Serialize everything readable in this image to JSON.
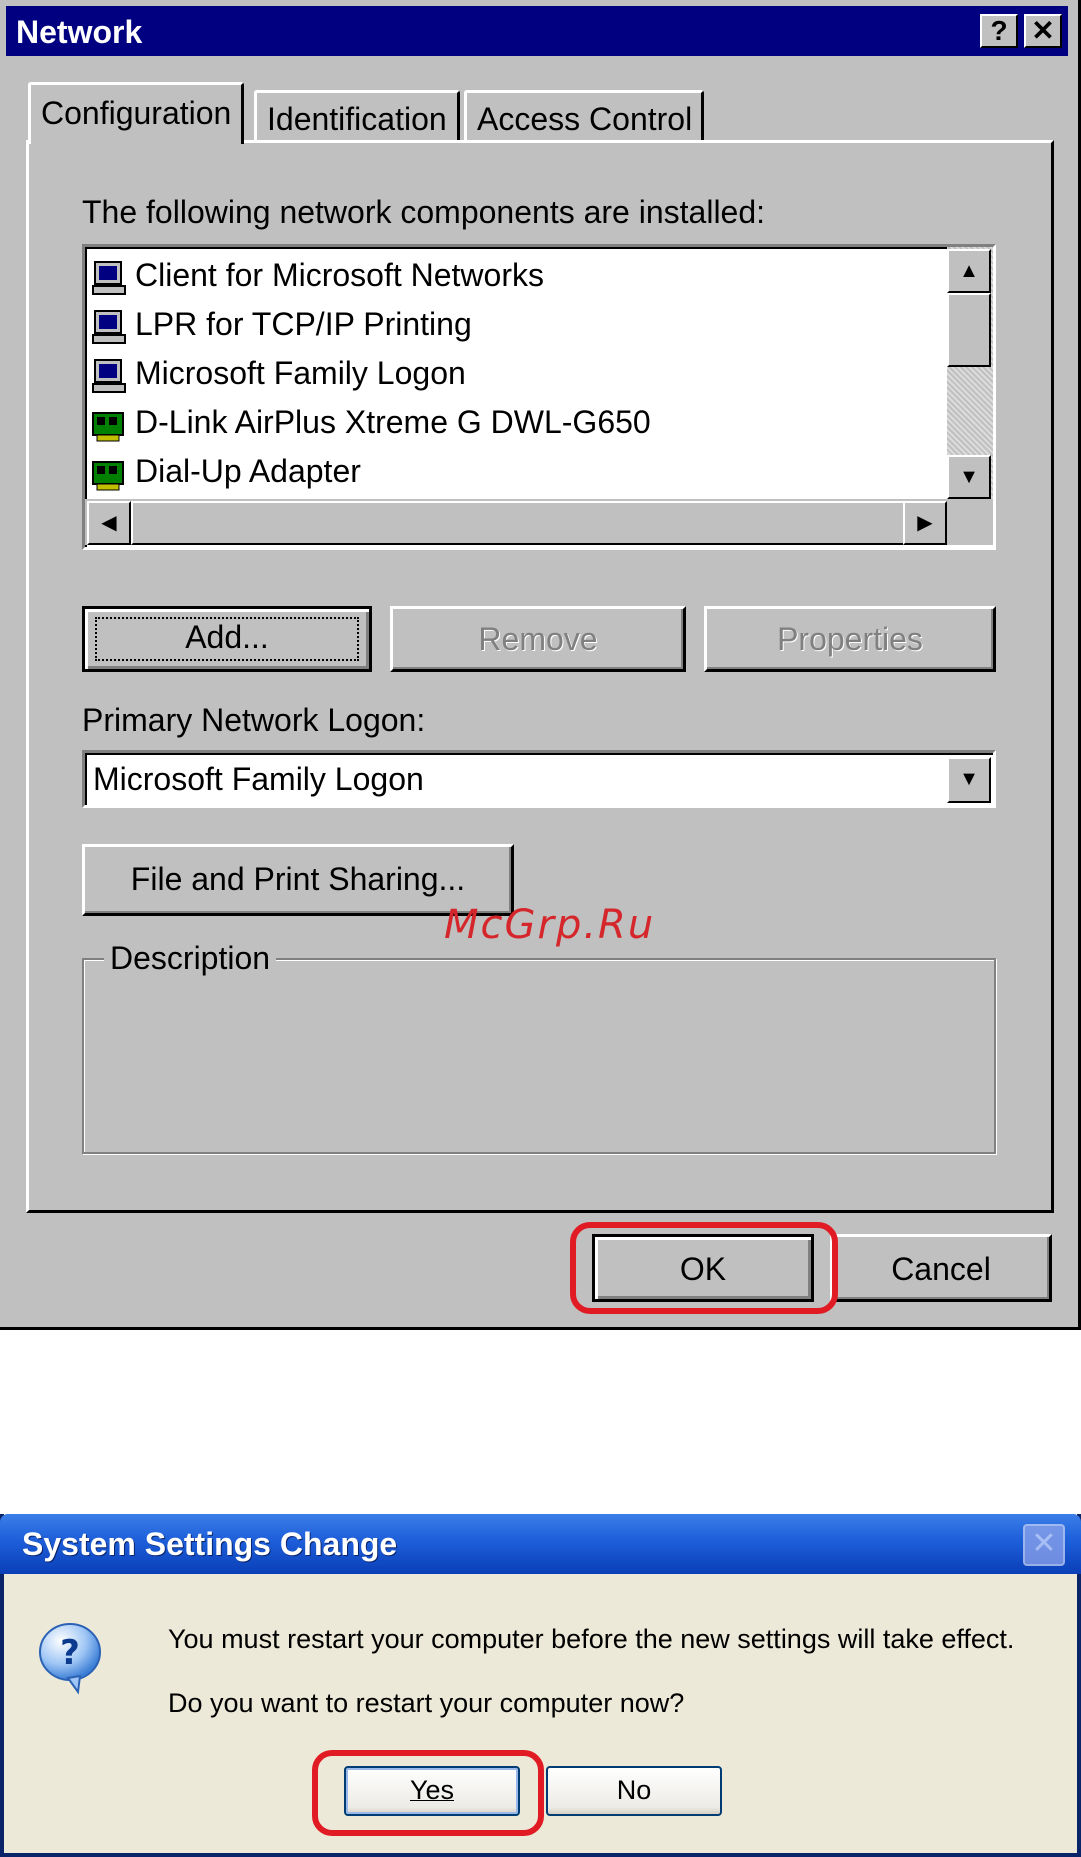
{
  "network_dialog": {
    "title": "Network",
    "help_glyph": "?",
    "close_glyph": "✕",
    "tabs": [
      {
        "label": "Configuration",
        "active": true
      },
      {
        "label": "Identification",
        "active": false
      },
      {
        "label": "Access Control",
        "active": false
      }
    ],
    "components_label": "The following network components are installed:",
    "components": [
      {
        "label": "Client for Microsoft Networks",
        "icon": "client-icon"
      },
      {
        "label": "LPR for TCP/IP Printing",
        "icon": "client-icon"
      },
      {
        "label": "Microsoft Family Logon",
        "icon": "client-icon"
      },
      {
        "label": "D-Link AirPlus Xtreme G DWL-G650",
        "icon": "adapter-icon"
      },
      {
        "label": "Dial-Up Adapter",
        "icon": "adapter-icon"
      }
    ],
    "buttons": {
      "add": "Add...",
      "remove": "Remove",
      "properties": "Properties"
    },
    "primary_logon_label": "Primary Network Logon:",
    "primary_logon_value": "Microsoft Family Logon",
    "file_print_sharing": "File and Print Sharing...",
    "description_label": "Description",
    "ok": "OK",
    "cancel": "Cancel"
  },
  "watermark": "McGrp.Ru",
  "restart_dialog": {
    "title": "System Settings Change",
    "message": "You must restart your computer before the new settings will take effect.",
    "question": "Do you want to restart your computer now?",
    "yes": "Yes",
    "no": "No",
    "close_glyph": "✕"
  },
  "colors": {
    "highlight": "#e01b24",
    "win98_title": "#000080",
    "xp_title": "#1d5ed9"
  }
}
